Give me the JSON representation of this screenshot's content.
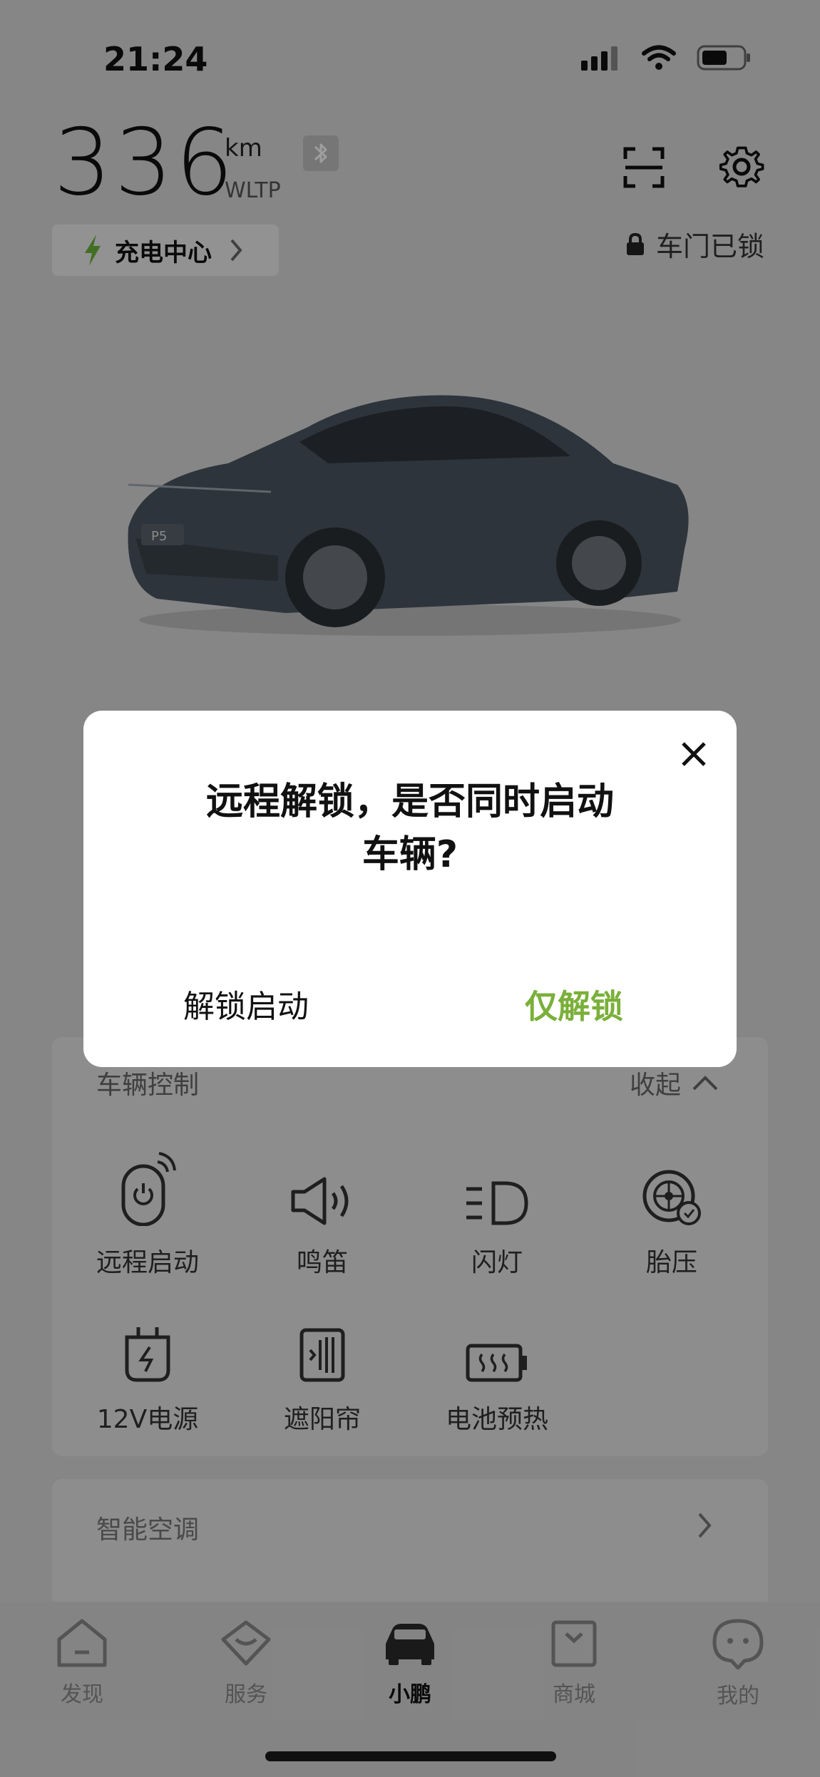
{
  "status_bar": {
    "time": "21:24"
  },
  "header": {
    "range_value": "336",
    "range_unit": "km",
    "range_standard": "WLTP",
    "charge_center_label": "充电中心",
    "door_status": "车门已锁"
  },
  "car": {
    "plate_text": "P5"
  },
  "vehicle_control": {
    "title": "车辆控制",
    "collapse_label": "收起",
    "items": [
      {
        "label": "远程启动",
        "icon": "remote-start-icon"
      },
      {
        "label": "鸣笛",
        "icon": "horn-icon"
      },
      {
        "label": "闪灯",
        "icon": "flash-lights-icon"
      },
      {
        "label": "胎压",
        "icon": "tire-pressure-icon"
      },
      {
        "label": "12V电源",
        "icon": "power-12v-icon"
      },
      {
        "label": "遮阳帘",
        "icon": "sunshade-icon"
      },
      {
        "label": "电池预热",
        "icon": "battery-preheat-icon"
      }
    ]
  },
  "smart_ac": {
    "title": "智能空调"
  },
  "tabbar": {
    "tabs": [
      {
        "label": "发现"
      },
      {
        "label": "服务"
      },
      {
        "label": "小鹏"
      },
      {
        "label": "商城"
      },
      {
        "label": "我的"
      }
    ],
    "active_index": 2
  },
  "dialog": {
    "title_line1": "远程解锁，是否同时启动",
    "title_line2": "车辆?",
    "unlock_start_label": "解锁启动",
    "unlock_only_label": "仅解锁"
  },
  "colors": {
    "accent_green": "#7ab03a",
    "overlay": "rgba(0,0,0,0.38)"
  }
}
